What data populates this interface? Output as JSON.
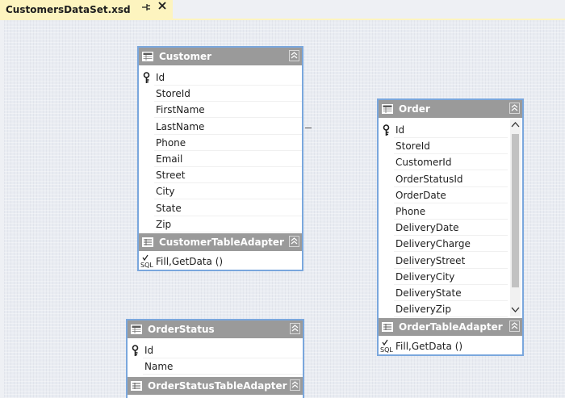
{
  "tab": {
    "title": "CustomersDataSet.xsd",
    "pin_glyph": "⊣",
    "close_glyph": "✕"
  },
  "customer": {
    "name": "Customer",
    "fields": [
      "Id",
      "StoreId",
      "FirstName",
      "LastName",
      "Phone",
      "Email",
      "Street",
      "City",
      "State",
      "Zip"
    ],
    "adapter": "CustomerTableAdapter",
    "methods": "Fill,GetData ()"
  },
  "order": {
    "name": "Order",
    "fields": [
      "Id",
      "StoreId",
      "CustomerId",
      "OrderStatusId",
      "OrderDate",
      "Phone",
      "DeliveryDate",
      "DeliveryCharge",
      "DeliveryStreet",
      "DeliveryCity",
      "DeliveryState",
      "DeliveryZip"
    ],
    "adapter": "OrderTableAdapter",
    "methods": "Fill,GetData ()"
  },
  "orderstatus": {
    "name": "OrderStatus",
    "fields": [
      "Id",
      "Name"
    ],
    "adapter": "OrderStatusTableAdapter"
  },
  "colors": {
    "header": "#9a9a9a",
    "border": "#7aa7dd",
    "tab": "#fdf4bf"
  }
}
